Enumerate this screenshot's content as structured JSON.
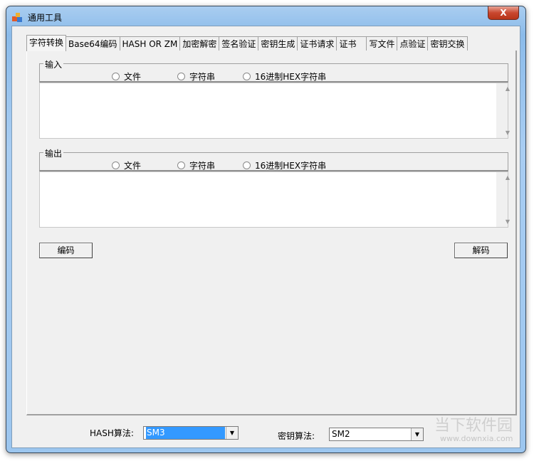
{
  "window": {
    "title": "通用工具",
    "close_label": "X"
  },
  "tabs": [
    "字符转换",
    "Base64编码",
    "HASH OR ZM",
    "加密解密",
    "签名验证",
    "密钥生成",
    "证书请求",
    "证书",
    "写文件",
    "点验证",
    "密钥交换"
  ],
  "input_group": {
    "label": "输入",
    "radios": [
      "文件",
      "字符串",
      "16进制HEX字符串"
    ]
  },
  "output_group": {
    "label": "输出",
    "radios": [
      "文件",
      "字符串",
      "16进制HEX字符串"
    ]
  },
  "buttons": {
    "encode": "编码",
    "decode": "解码"
  },
  "bottom": {
    "hash_label": "HASH算法:",
    "hash_value": "SM3",
    "key_label": "密钥算法:",
    "key_value": "SM2"
  },
  "watermark": {
    "name": "当下软件园",
    "url": "www.downxia.com"
  }
}
